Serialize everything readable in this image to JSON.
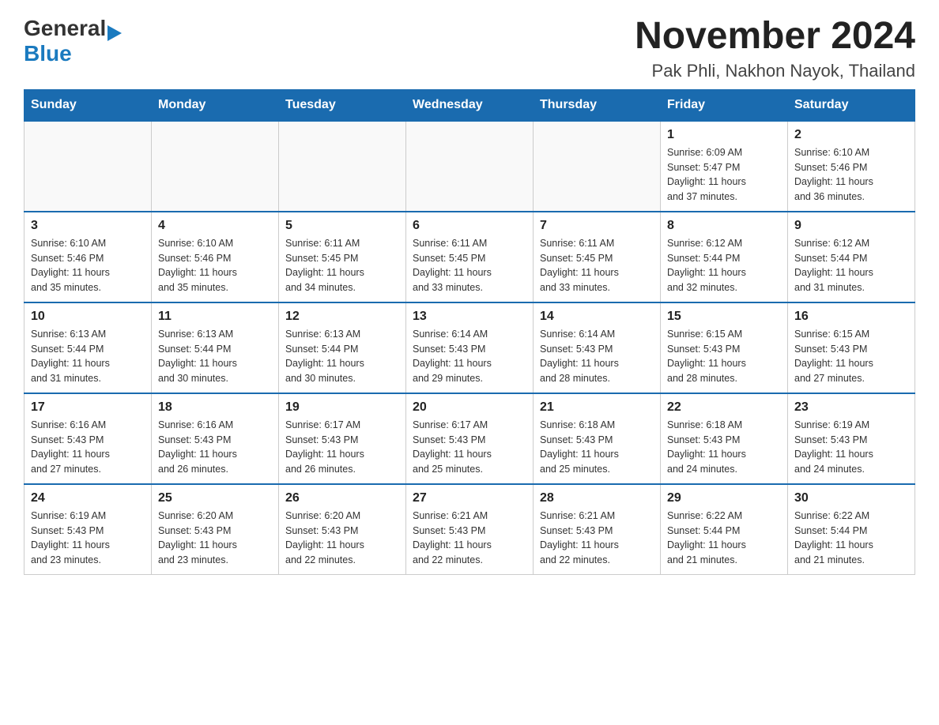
{
  "header": {
    "logo": {
      "general": "General",
      "blue": "Blue",
      "arrow": "▶"
    },
    "month_year": "November 2024",
    "location": "Pak Phli, Nakhon Nayok, Thailand"
  },
  "days_of_week": [
    "Sunday",
    "Monday",
    "Tuesday",
    "Wednesday",
    "Thursday",
    "Friday",
    "Saturday"
  ],
  "weeks": [
    {
      "days": [
        {
          "number": "",
          "info": ""
        },
        {
          "number": "",
          "info": ""
        },
        {
          "number": "",
          "info": ""
        },
        {
          "number": "",
          "info": ""
        },
        {
          "number": "",
          "info": ""
        },
        {
          "number": "1",
          "info": "Sunrise: 6:09 AM\nSunset: 5:47 PM\nDaylight: 11 hours\nand 37 minutes."
        },
        {
          "number": "2",
          "info": "Sunrise: 6:10 AM\nSunset: 5:46 PM\nDaylight: 11 hours\nand 36 minutes."
        }
      ]
    },
    {
      "days": [
        {
          "number": "3",
          "info": "Sunrise: 6:10 AM\nSunset: 5:46 PM\nDaylight: 11 hours\nand 35 minutes."
        },
        {
          "number": "4",
          "info": "Sunrise: 6:10 AM\nSunset: 5:46 PM\nDaylight: 11 hours\nand 35 minutes."
        },
        {
          "number": "5",
          "info": "Sunrise: 6:11 AM\nSunset: 5:45 PM\nDaylight: 11 hours\nand 34 minutes."
        },
        {
          "number": "6",
          "info": "Sunrise: 6:11 AM\nSunset: 5:45 PM\nDaylight: 11 hours\nand 33 minutes."
        },
        {
          "number": "7",
          "info": "Sunrise: 6:11 AM\nSunset: 5:45 PM\nDaylight: 11 hours\nand 33 minutes."
        },
        {
          "number": "8",
          "info": "Sunrise: 6:12 AM\nSunset: 5:44 PM\nDaylight: 11 hours\nand 32 minutes."
        },
        {
          "number": "9",
          "info": "Sunrise: 6:12 AM\nSunset: 5:44 PM\nDaylight: 11 hours\nand 31 minutes."
        }
      ]
    },
    {
      "days": [
        {
          "number": "10",
          "info": "Sunrise: 6:13 AM\nSunset: 5:44 PM\nDaylight: 11 hours\nand 31 minutes."
        },
        {
          "number": "11",
          "info": "Sunrise: 6:13 AM\nSunset: 5:44 PM\nDaylight: 11 hours\nand 30 minutes."
        },
        {
          "number": "12",
          "info": "Sunrise: 6:13 AM\nSunset: 5:44 PM\nDaylight: 11 hours\nand 30 minutes."
        },
        {
          "number": "13",
          "info": "Sunrise: 6:14 AM\nSunset: 5:43 PM\nDaylight: 11 hours\nand 29 minutes."
        },
        {
          "number": "14",
          "info": "Sunrise: 6:14 AM\nSunset: 5:43 PM\nDaylight: 11 hours\nand 28 minutes."
        },
        {
          "number": "15",
          "info": "Sunrise: 6:15 AM\nSunset: 5:43 PM\nDaylight: 11 hours\nand 28 minutes."
        },
        {
          "number": "16",
          "info": "Sunrise: 6:15 AM\nSunset: 5:43 PM\nDaylight: 11 hours\nand 27 minutes."
        }
      ]
    },
    {
      "days": [
        {
          "number": "17",
          "info": "Sunrise: 6:16 AM\nSunset: 5:43 PM\nDaylight: 11 hours\nand 27 minutes."
        },
        {
          "number": "18",
          "info": "Sunrise: 6:16 AM\nSunset: 5:43 PM\nDaylight: 11 hours\nand 26 minutes."
        },
        {
          "number": "19",
          "info": "Sunrise: 6:17 AM\nSunset: 5:43 PM\nDaylight: 11 hours\nand 26 minutes."
        },
        {
          "number": "20",
          "info": "Sunrise: 6:17 AM\nSunset: 5:43 PM\nDaylight: 11 hours\nand 25 minutes."
        },
        {
          "number": "21",
          "info": "Sunrise: 6:18 AM\nSunset: 5:43 PM\nDaylight: 11 hours\nand 25 minutes."
        },
        {
          "number": "22",
          "info": "Sunrise: 6:18 AM\nSunset: 5:43 PM\nDaylight: 11 hours\nand 24 minutes."
        },
        {
          "number": "23",
          "info": "Sunrise: 6:19 AM\nSunset: 5:43 PM\nDaylight: 11 hours\nand 24 minutes."
        }
      ]
    },
    {
      "days": [
        {
          "number": "24",
          "info": "Sunrise: 6:19 AM\nSunset: 5:43 PM\nDaylight: 11 hours\nand 23 minutes."
        },
        {
          "number": "25",
          "info": "Sunrise: 6:20 AM\nSunset: 5:43 PM\nDaylight: 11 hours\nand 23 minutes."
        },
        {
          "number": "26",
          "info": "Sunrise: 6:20 AM\nSunset: 5:43 PM\nDaylight: 11 hours\nand 22 minutes."
        },
        {
          "number": "27",
          "info": "Sunrise: 6:21 AM\nSunset: 5:43 PM\nDaylight: 11 hours\nand 22 minutes."
        },
        {
          "number": "28",
          "info": "Sunrise: 6:21 AM\nSunset: 5:43 PM\nDaylight: 11 hours\nand 22 minutes."
        },
        {
          "number": "29",
          "info": "Sunrise: 6:22 AM\nSunset: 5:44 PM\nDaylight: 11 hours\nand 21 minutes."
        },
        {
          "number": "30",
          "info": "Sunrise: 6:22 AM\nSunset: 5:44 PM\nDaylight: 11 hours\nand 21 minutes."
        }
      ]
    }
  ]
}
